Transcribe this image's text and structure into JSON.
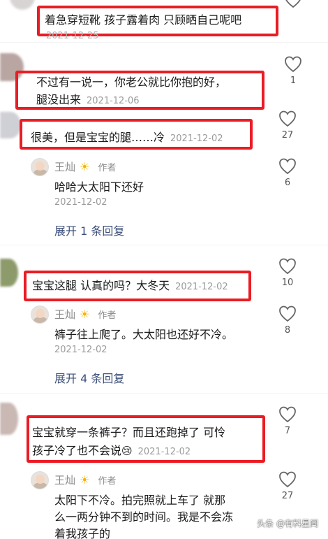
{
  "comments": [
    {
      "text": "着急穿短靴 孩子露着肉 只顾晒自己呢吧",
      "date": "2021-12-25"
    },
    {
      "text1": "不过有一说一，你老公就比你抱的好，",
      "text2": "腿没出来",
      "date": "2021-12-06",
      "likes": "1"
    },
    {
      "text": "很美，但是宝宝的腿……冷",
      "date": "2021-12-02",
      "likes": "27",
      "reply": {
        "author": "王灿",
        "badge": "作者",
        "text": "哈哈大太阳下还好",
        "date": "2021-12-02",
        "likes": "6"
      },
      "expand": "展开 1 条回复"
    },
    {
      "text": "宝宝这腿 认真的吗？大冬天",
      "date": "2021-12-02",
      "likes": "10",
      "reply": {
        "author": "王灿",
        "badge": "作者",
        "text": "裤子往上爬了。大太阳也还好不冷。",
        "date": "2021-12-02",
        "likes": "8"
      },
      "expand": "展开 4 条回复"
    },
    {
      "text1": "宝宝就穿一条裤子？而且还跑掉了 可怜",
      "text2": "孩子冷了也不会说",
      "date": "2021-12-02",
      "likes": "7",
      "reply": {
        "author": "王灿",
        "badge": "作者",
        "text1": "太阳下不冷。拍完照就上车了 就那",
        "text2": "么一两分钟不到的时间。我是不会冻",
        "text3": "着我孩子的",
        "likes": "27"
      }
    }
  ],
  "watermark": "头条 @有料星闻",
  "colors": {
    "highlight": "#ea1c24",
    "link": "#3d4f7a",
    "muted": "#9a9a9a"
  }
}
